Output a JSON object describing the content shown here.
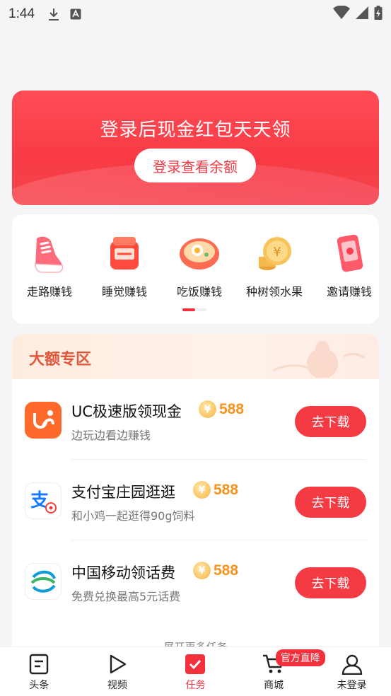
{
  "status_bar": {
    "time": "1:44"
  },
  "banner": {
    "title": "登录后现金红包天天领",
    "button_label": "登录查看余额"
  },
  "earn_ways": {
    "items": [
      {
        "label": "走路赚钱",
        "icon": "sneaker-icon"
      },
      {
        "label": "睡觉赚钱",
        "icon": "alarm-clock-icon"
      },
      {
        "label": "吃饭赚钱",
        "icon": "noodle-bowl-icon"
      },
      {
        "label": "种树领水果",
        "icon": "coin-stack-icon"
      },
      {
        "label": "邀请赚钱",
        "icon": "red-envelope-phone-icon"
      }
    ],
    "page_count": 2,
    "active_page": 1
  },
  "zone": {
    "title": "大额专区",
    "tasks": [
      {
        "name": "UC极速版领现金",
        "reward": "588",
        "desc": "边玩边看边赚钱",
        "button": "去下载",
        "icon": "uc-browser-icon"
      },
      {
        "name": "支付宝庄园逛逛",
        "reward": "588",
        "desc": "和小鸡一起逛得90g饲料",
        "button": "去下载",
        "icon": "alipay-farm-icon"
      },
      {
        "name": "中国移动领话费",
        "reward": "588",
        "desc": "免费兑换最高5元话费",
        "button": "去下载",
        "icon": "china-mobile-icon"
      }
    ],
    "more_label": "展开更多任务"
  },
  "bottom_nav": {
    "items": [
      {
        "label": "头条"
      },
      {
        "label": "视频"
      },
      {
        "label": "任务"
      },
      {
        "label": "商城",
        "badge": "官方直降"
      },
      {
        "label": "未登录"
      }
    ],
    "active": "任务"
  },
  "colors": {
    "accent": "#f2313c",
    "reward": "#f7931e",
    "zone_title": "#e2563a"
  }
}
